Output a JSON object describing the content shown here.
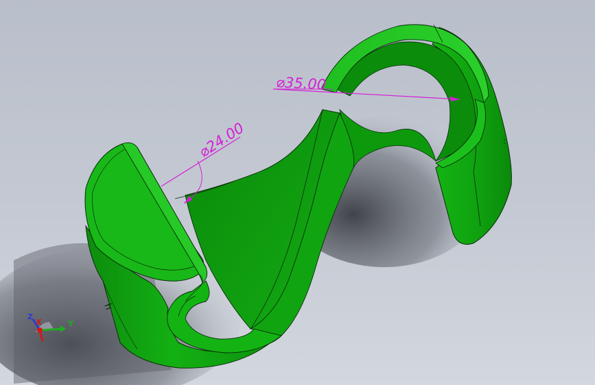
{
  "model": {
    "body_color": "#0fa00f",
    "highlight_color": "#2ed42e",
    "shadow_color": "#087808",
    "edge_color": "#0a2a0a"
  },
  "dimensions": {
    "color": "#d41fd4",
    "diameter_large": "⌀35.00",
    "diameter_small": "⌀24.00"
  },
  "triad": {
    "z_label": "Z",
    "x_label": "X",
    "y_label": "Y",
    "z_color": "#2a3ccf",
    "x_color": "#d21a1a",
    "y_color": "#1fae1f"
  }
}
